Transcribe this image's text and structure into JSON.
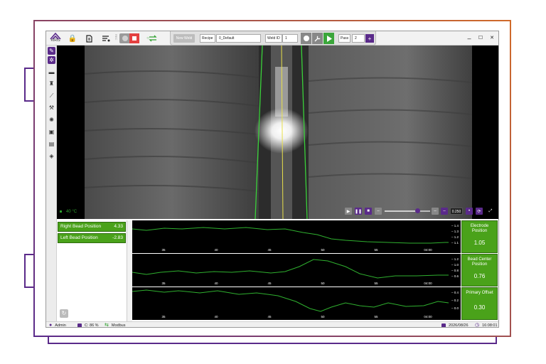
{
  "app": {
    "logo_text": "KIRIS"
  },
  "toolbar": {
    "rec_label": "REC",
    "new_weld_label": "New Weld",
    "recipe_label": "Recipe",
    "recipe_value": "0_Default",
    "weld_id_label": "Weld ID",
    "weld_id_value": "1",
    "pass_label": "Pass",
    "pass_value": "2",
    "plus_label": "+"
  },
  "window": {
    "minimize": "–",
    "maximize": "☐",
    "close": "✕"
  },
  "video": {
    "temperature": "40 °C",
    "speed": "0.250"
  },
  "positions": [
    {
      "label": "Right Bead Position",
      "value": "4.33"
    },
    {
      "label": "Left Bead Position",
      "value": "-2.83"
    }
  ],
  "charts": [
    {
      "name": "Electrode Position",
      "value": "1.05",
      "yticks": [
        "1.4",
        "1.3",
        "1.2",
        "1.1"
      ],
      "xticks": [
        "35",
        "40",
        "45",
        "50",
        "55",
        "04:00"
      ]
    },
    {
      "name": "Bead Center Position",
      "value": "0.76",
      "yticks": [
        "1.2",
        "1.0",
        "0.8",
        "0.6"
      ],
      "xticks": [
        "35",
        "40",
        "45",
        "50",
        "55",
        "04:00"
      ]
    },
    {
      "name": "Primary Offset",
      "value": "0.30",
      "yticks": [
        "0.4",
        "0.2",
        "0.0"
      ],
      "xticks": [
        "35",
        "40",
        "45",
        "50",
        "55",
        "04:00"
      ]
    }
  ],
  "status": {
    "user": "Admin",
    "disk": "C: 86 %",
    "protocol": "Modbus",
    "date": "2026/08/26",
    "time": "16:08:01"
  },
  "colors": {
    "accent": "#5a2a8a",
    "status_green": "#4aa21a",
    "trace_green": "#2fb02f",
    "record_red": "#e34040"
  }
}
